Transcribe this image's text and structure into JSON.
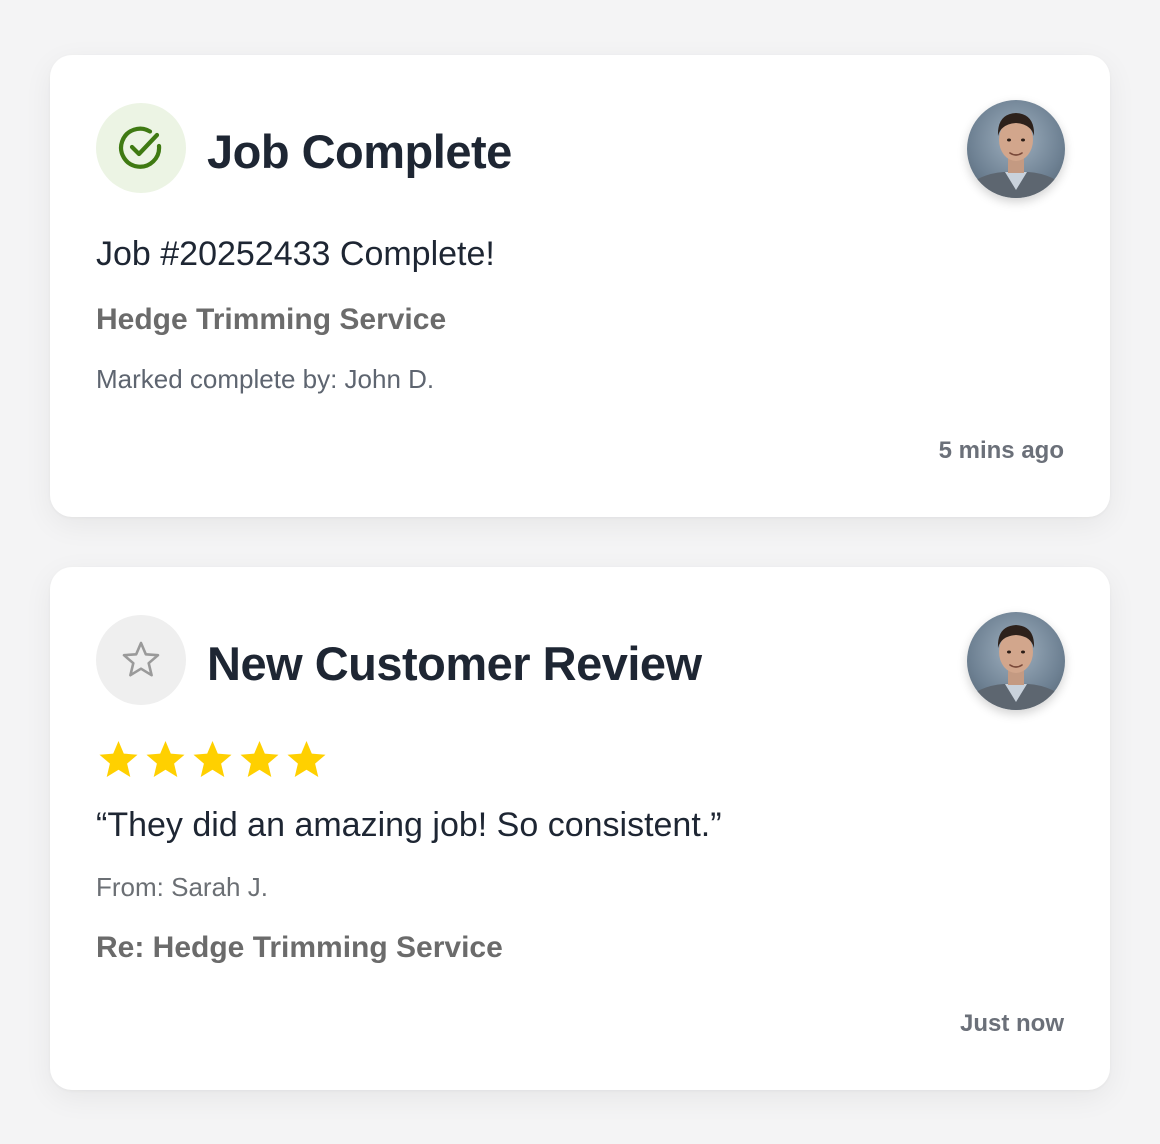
{
  "notifications": [
    {
      "title": "Job Complete",
      "icon": "check-circle-icon",
      "icon_color": "#3f7a12",
      "icon_bg": "#ecf4e4",
      "heading": "Job #20252433 Complete!",
      "service": "Hedge Trimming Service",
      "marked_by": "Marked complete by: John D.",
      "time": "5 mins ago"
    },
    {
      "title": "New Customer Review",
      "icon": "star-outline-icon",
      "icon_color": "#9a9a9a",
      "icon_bg": "#efefef",
      "rating": 5,
      "rating_max": 5,
      "star_color": "#ffd000",
      "quote": "“They did an amazing job! So consistent.”",
      "from": "From: Sarah J.",
      "re": "Re: Hedge Trimming Service",
      "time": "Just now"
    }
  ]
}
